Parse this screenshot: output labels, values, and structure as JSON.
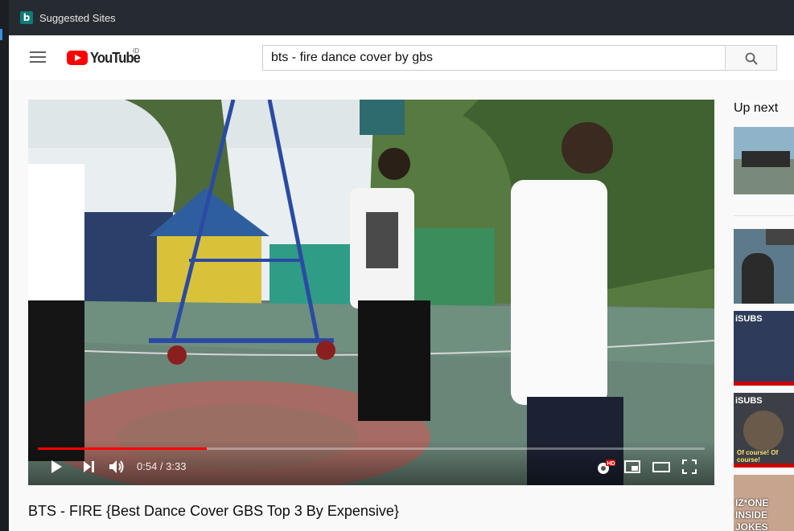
{
  "browser": {
    "bookmark_icon_letter": "b",
    "bookmark_label": "Suggested Sites"
  },
  "masthead": {
    "logo_text": "YouTube",
    "country_code": "ID",
    "search_query": "bts - fire dance cover by gbs",
    "icons": [
      "menu-icon",
      "youtube-logo",
      "search-icon"
    ]
  },
  "player": {
    "current_time": "0:54",
    "duration": "3:33",
    "time_display": "0:54 / 3:33",
    "progress": 0.2535,
    "quality_badge": "HD",
    "icons": [
      "play-icon",
      "next-icon",
      "volume-icon",
      "settings-icon",
      "miniplayer-icon",
      "theater-icon",
      "fullscreen-icon"
    ]
  },
  "video": {
    "title": "BTS - FIRE {Best Dance Cover GBS Top 3 By Expensive}"
  },
  "sidebar": {
    "up_next_label": "Up next",
    "thumbnails": [
      {
        "overlay": ""
      },
      {
        "overlay": ""
      },
      {
        "overlay": "iSUBS"
      },
      {
        "overlay": "iSUBS",
        "caption": "Of course! Of course!"
      },
      {
        "overlay": "IZ*ONE INSIDE JOKES"
      }
    ]
  },
  "colors": {
    "brand_red": "#ff0000",
    "browser_bar": "#262b31",
    "page_bg": "#f9f9f9"
  }
}
